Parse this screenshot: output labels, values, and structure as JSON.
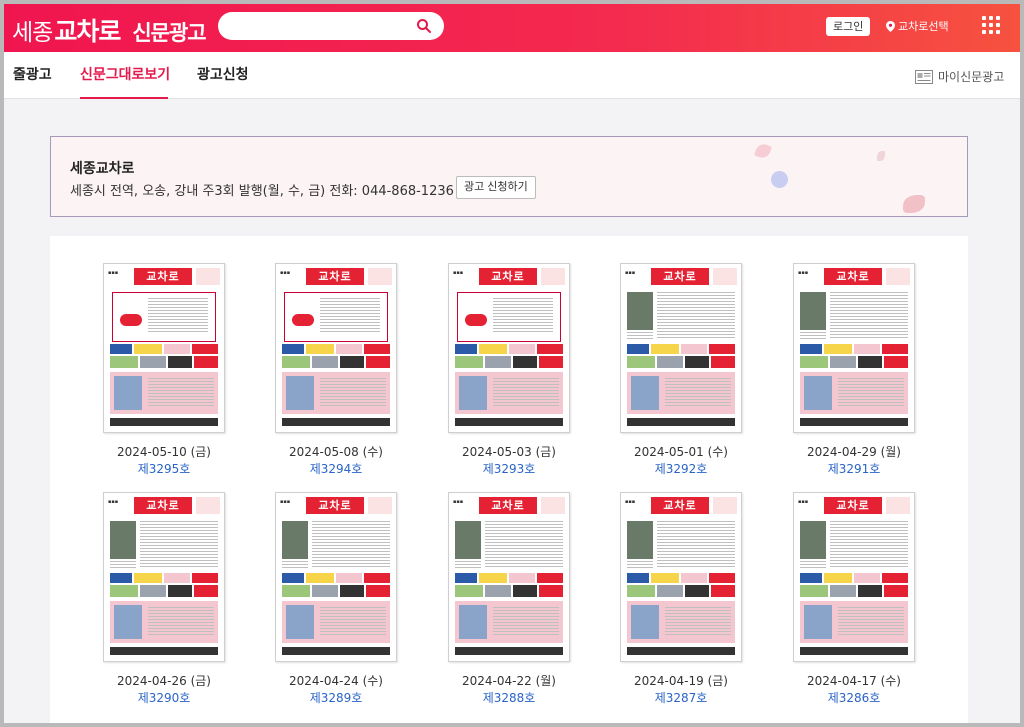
{
  "header": {
    "logo_region": "세종",
    "logo_name": "교차로",
    "logo_service": "신문광고",
    "search_placeholder": "",
    "login_label": "로그인",
    "region_label": "교차로선택",
    "icons": [
      "search-icon",
      "location-pin-icon",
      "apps-grid-icon"
    ]
  },
  "tabs": [
    {
      "label": "줄광고"
    },
    {
      "label": "신문그대로보기"
    },
    {
      "label": "광고신청"
    }
  ],
  "active_tab": "신문그대로보기",
  "my_ads_label": "마이신문광고",
  "banner": {
    "title": "세종교차로",
    "description": "세종시 전역, 오송, 강내 주3회 발행(월, 수, 금) 전화: 044-868-1236",
    "apply_label": "광고 신청하기"
  },
  "issues": [
    {
      "date": "2024-05-10 (금)",
      "issue": "제3295호",
      "variant": "ad"
    },
    {
      "date": "2024-05-08 (수)",
      "issue": "제3294호",
      "variant": "ad"
    },
    {
      "date": "2024-05-03 (금)",
      "issue": "제3293호",
      "variant": "ad"
    },
    {
      "date": "2024-05-01 (수)",
      "issue": "제3292호",
      "variant": "article"
    },
    {
      "date": "2024-04-29 (월)",
      "issue": "제3291호",
      "variant": "article"
    },
    {
      "date": "2024-04-26 (금)",
      "issue": "제3290호",
      "variant": "article"
    },
    {
      "date": "2024-04-24 (수)",
      "issue": "제3289호",
      "variant": "article"
    },
    {
      "date": "2024-04-22 (월)",
      "issue": "제3288호",
      "variant": "article"
    },
    {
      "date": "2024-04-19 (금)",
      "issue": "제3287호",
      "variant": "article"
    },
    {
      "date": "2024-04-17 (수)",
      "issue": "제3286호",
      "variant": "article"
    }
  ],
  "newspaper_masthead": "교차로",
  "colors": {
    "brand": "#f0154f",
    "active_tab": "#e6194b",
    "issue_link": "#2a64c8"
  }
}
